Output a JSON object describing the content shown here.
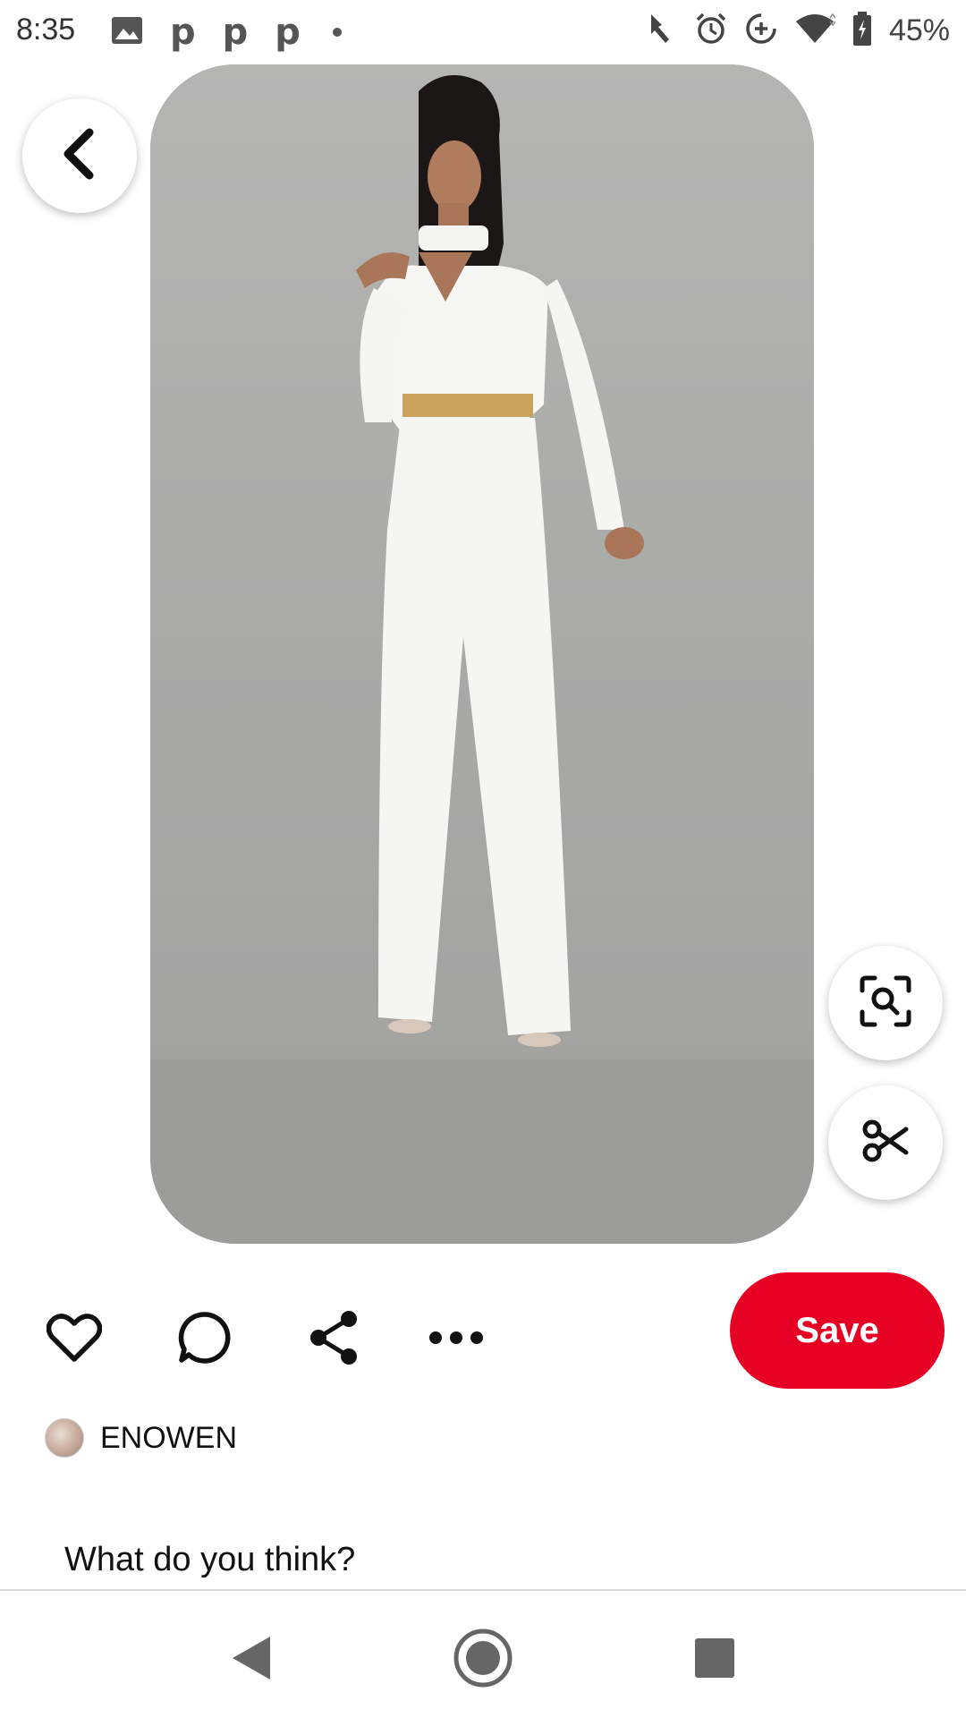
{
  "status_bar": {
    "time": "8:35",
    "left_icons": [
      "image-icon",
      "pinterest-p-icon",
      "pinterest-p-icon",
      "pinterest-p-icon",
      "dot-icon"
    ],
    "p_glyph": "p",
    "right_icons": [
      "touch-icon",
      "alarm-icon",
      "data-saver-icon",
      "wifi-icon",
      "battery-icon"
    ],
    "battery": "45%"
  },
  "pin": {
    "image_alt_icon": "pin-photo",
    "background_color": "#9c9c9a"
  },
  "floating": {
    "back_icon": "chevron-left-icon",
    "lens_icon": "visual-search-icon",
    "cut_icon": "scissors-icon"
  },
  "actions": {
    "icons": [
      "heart-icon",
      "comment-icon",
      "share-icon",
      "more-icon"
    ],
    "save_label": "Save",
    "save_color": "#e60023"
  },
  "creator": {
    "name": "ENOWEN"
  },
  "comment_prompt": "What do you think?",
  "nav": {
    "icons": [
      "nav-back-icon",
      "nav-home-icon",
      "nav-recents-icon"
    ]
  }
}
